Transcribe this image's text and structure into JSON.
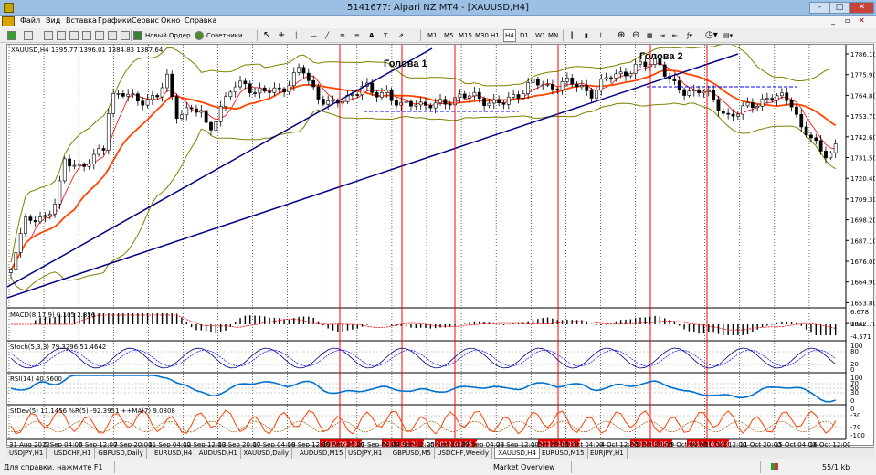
{
  "window": {
    "title": "5141677: Alpari NZ MT4 - [XAUUSD,H4]"
  },
  "menu": [
    "Файл",
    "Вид",
    "Вставка",
    "Графики",
    "Сервис",
    "Окно",
    "Справка"
  ],
  "toolbar": {
    "new_order": "Новый Ордер",
    "advisors": "Советники",
    "timeframes": [
      "M1",
      "M5",
      "M15",
      "M30",
      "H1",
      "H4",
      "D1",
      "W1",
      "MN"
    ],
    "active_timeframe": "H4"
  },
  "chart": {
    "symbol_line": "XAUUSD,H4  1395.77 1396.01 1384.83 1387.64",
    "annotations": {
      "head1": "Голова 1",
      "head2": "Голова 2"
    },
    "price_axis": [
      "1786.10",
      "1775.90",
      "1764.80",
      "1753.70",
      "1742.60",
      "1731.50",
      "1720.40",
      "1709.30",
      "1698.20",
      "1687.10",
      "1676.00",
      "1664.90",
      "1653.80",
      "1642.70"
    ],
    "time_axis": [
      "31 Aug 2012",
      "5 Sep 04:00",
      "6 Sep 12:00",
      "7 Sep 20:00",
      "11 Sep 04:00",
      "12 Sep 12:00",
      "13 Sep 20:00",
      "17 Sep 04:00",
      "18 Sep 12:00",
      "19 Sep 20:00",
      "21 Sep 04:00",
      "24 Sep 12:00",
      "25 Sep 20:00",
      "27 Sep 04:00",
      "28 Sep 12:00",
      "1 Oct 20:00",
      "3 Oct 04:00",
      "4 Oct 12:00",
      "5 Oct 20:00",
      "9 Oct 04:00",
      "10 Oct 12:00",
      "11 Oct 20:00",
      "15 Oct 04:00",
      "16 Oct 12:00"
    ],
    "red_date_labels": [
      "2012.09.19 08:00",
      "2012.09.21 16:00",
      "2012.09.25 16:00",
      "2012.10.01 16:00",
      "2012.10.05 04:00",
      "2012.10.09 08:00"
    ],
    "panels": {
      "macd": {
        "label": "MACD(8,17,9) 0.105 2.856",
        "axis": [
          "6.678",
          "0.00",
          "-4.571"
        ]
      },
      "stoch": {
        "label": "Stoch(5,3,3) 79.3296 51.4642",
        "axis": [
          "100",
          "80",
          "20",
          "0"
        ]
      },
      "rsi": {
        "label": "RSI(14) 40.5600",
        "axis": [
          "100",
          "70",
          "50",
          "30",
          "0"
        ]
      },
      "wpr": {
        "label": "StDev(5) 11.1456  %R(5) -92.3951  ++MA(7) 9.0808",
        "axis": [
          "0",
          "-30",
          "-70",
          "-100"
        ]
      }
    },
    "colors": {
      "candle": "#000000",
      "bands": "#808000",
      "ma_fast": "#ff0000",
      "ma_slow": "#ff4500",
      "trendline": "#000080",
      "redline": "#ff0000",
      "dashed_level": "#0000ff"
    }
  },
  "tabs": [
    "USDJPY,H1",
    "USDCHF,H1",
    "GBPUSD,Daily",
    "EURUSD,H4",
    "AUDUSD,H1",
    "XAUUSD,Daily",
    "AUDUSD,M15",
    "USDJPY,H1",
    "GBPUSD,M5",
    "USDCHF,Weekly",
    "XAUUSD,H4",
    "EURUSD,M15",
    "EURJPY,H1"
  ],
  "active_tab": "XAUUSD,H4",
  "status": {
    "help": "Для справки, нажмите F1",
    "profile": "Market Overview",
    "traffic": "55/1 kb"
  }
}
